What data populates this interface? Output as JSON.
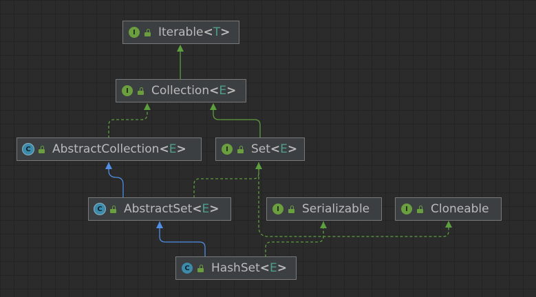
{
  "colors": {
    "background": "#2b2b2b",
    "node_fill": "#3c3f41",
    "node_border": "#7a7a7a",
    "interface_badge": "#6a9e3f",
    "class_badge": "#3d8bab",
    "extends_class_arrow": "#4f8fe6",
    "interface_arrow": "#5d9e3e",
    "type_param": "#4f9e8e"
  },
  "nodes": {
    "iterable": {
      "kind_letter": "I",
      "kind_icon": "interface-icon",
      "name": "Iterable",
      "open": "<",
      "param": "T",
      "close": ">"
    },
    "collection": {
      "kind_letter": "I",
      "kind_icon": "interface-icon",
      "name": "Collection",
      "open": "<",
      "param": "E",
      "close": ">"
    },
    "abstract_collection": {
      "kind_letter": "C",
      "kind_icon": "abstract-class-icon",
      "name": "AbstractCollection",
      "open": "<",
      "param": "E",
      "close": ">"
    },
    "set": {
      "kind_letter": "I",
      "kind_icon": "interface-icon",
      "name": "Set",
      "open": "<",
      "param": "E",
      "close": ">"
    },
    "abstract_set": {
      "kind_letter": "C",
      "kind_icon": "abstract-class-icon",
      "name": "AbstractSet",
      "open": "<",
      "param": "E",
      "close": ">"
    },
    "serializable": {
      "kind_letter": "I",
      "kind_icon": "interface-icon",
      "name": "Serializable"
    },
    "cloneable": {
      "kind_letter": "I",
      "kind_icon": "interface-icon",
      "name": "Cloneable"
    },
    "hashset": {
      "kind_letter": "C",
      "kind_icon": "class-icon",
      "name": "HashSet",
      "open": "<",
      "param": "E",
      "close": ">"
    }
  },
  "edges": [
    {
      "from": "collection",
      "to": "iterable",
      "style": "solid-green"
    },
    {
      "from": "abstract_collection",
      "to": "collection",
      "style": "dashed-green"
    },
    {
      "from": "set",
      "to": "collection",
      "style": "solid-green"
    },
    {
      "from": "abstract_set",
      "to": "abstract_collection",
      "style": "solid-blue"
    },
    {
      "from": "abstract_set",
      "to": "set",
      "style": "dashed-green"
    },
    {
      "from": "hashset",
      "to": "abstract_set",
      "style": "solid-blue"
    },
    {
      "from": "hashset",
      "to": "set",
      "style": "dashed-green"
    },
    {
      "from": "hashset",
      "to": "serializable",
      "style": "dashed-green"
    },
    {
      "from": "hashset",
      "to": "cloneable",
      "style": "dashed-green"
    }
  ]
}
